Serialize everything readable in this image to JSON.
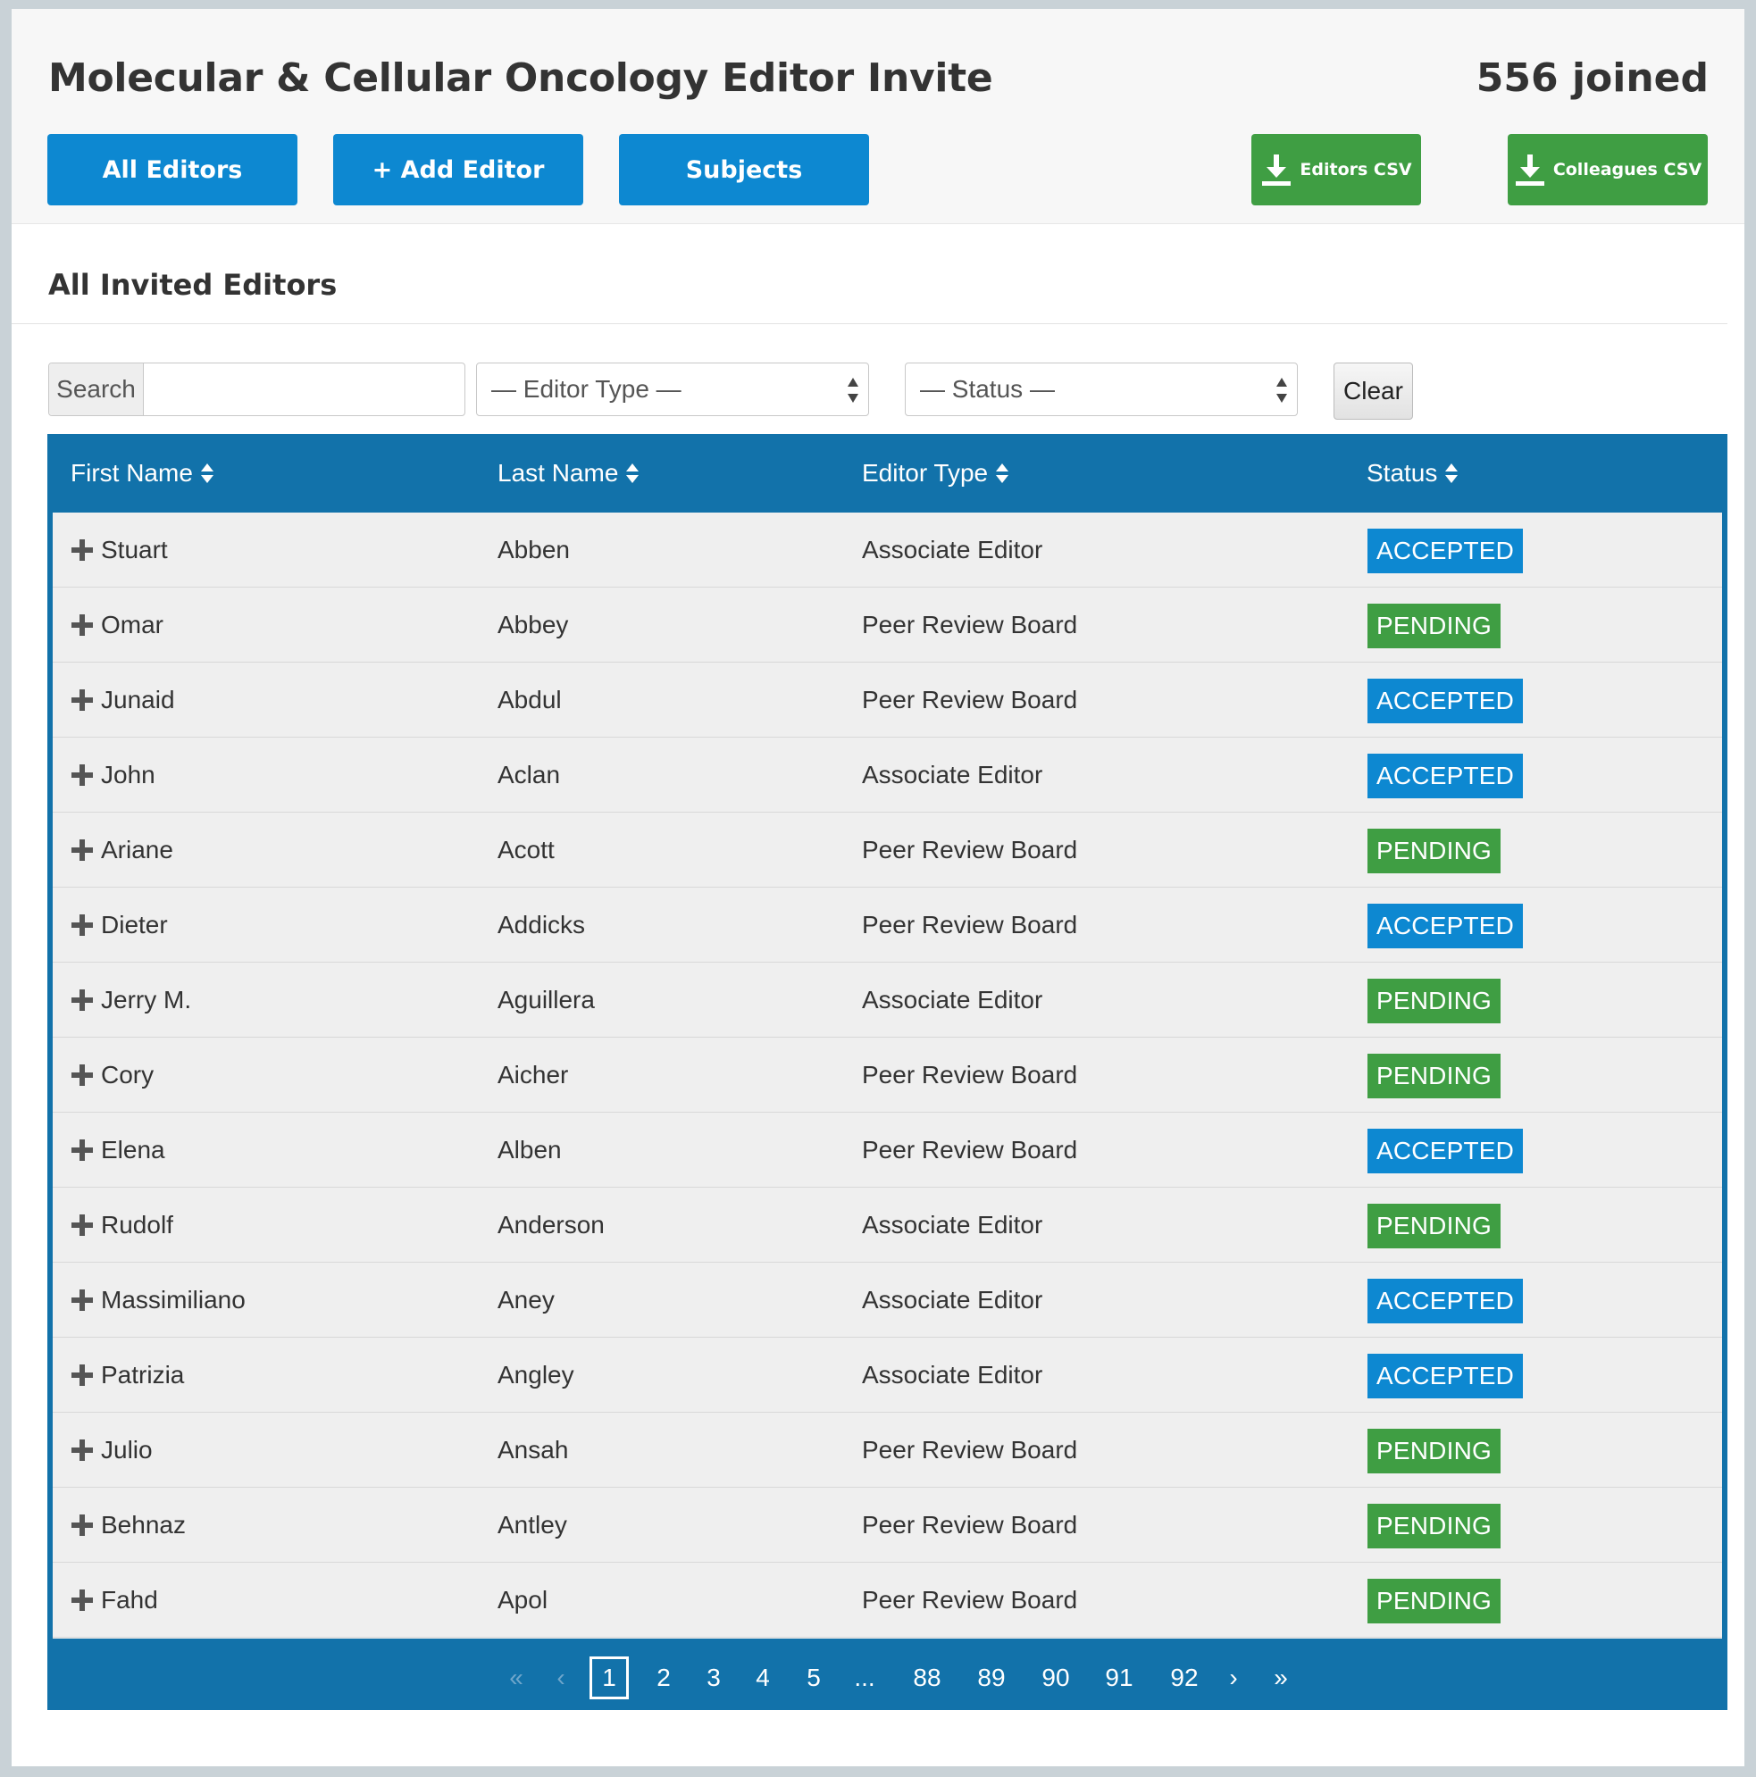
{
  "header": {
    "title": "Molecular & Cellular Oncology Editor Invite",
    "joined": "556 joined",
    "buttons": {
      "all_editors": "All Editors",
      "add_editor": "+ Add Editor",
      "subjects": "Subjects",
      "editors_csv": "Editors CSV",
      "colleagues_csv": "Colleagues CSV"
    }
  },
  "section": {
    "title": "All Invited Editors"
  },
  "filters": {
    "search_label": "Search",
    "search_value": "",
    "editor_type": "— Editor Type —",
    "status": "— Status —",
    "clear": "Clear"
  },
  "table": {
    "columns": [
      "First Name",
      "Last Name",
      "Editor Type",
      "Status"
    ],
    "rows": [
      {
        "first": "Stuart",
        "last": "Abben",
        "type": "Associate Editor",
        "status": "ACCEPTED"
      },
      {
        "first": "Omar",
        "last": "Abbey",
        "type": "Peer Review Board",
        "status": "PENDING"
      },
      {
        "first": "Junaid",
        "last": "Abdul",
        "type": "Peer Review Board",
        "status": "ACCEPTED"
      },
      {
        "first": "John",
        "last": "Aclan",
        "type": "Associate Editor",
        "status": "ACCEPTED"
      },
      {
        "first": "Ariane",
        "last": "Acott",
        "type": "Peer Review Board",
        "status": "PENDING"
      },
      {
        "first": "Dieter",
        "last": "Addicks",
        "type": "Peer Review Board",
        "status": "ACCEPTED"
      },
      {
        "first": "Jerry M.",
        "last": "Aguillera",
        "type": "Associate Editor",
        "status": "PENDING"
      },
      {
        "first": "Cory",
        "last": "Aicher",
        "type": "Peer Review Board",
        "status": "PENDING"
      },
      {
        "first": "Elena",
        "last": "Alben",
        "type": "Peer Review Board",
        "status": "ACCEPTED"
      },
      {
        "first": "Rudolf",
        "last": "Anderson",
        "type": "Associate Editor",
        "status": "PENDING"
      },
      {
        "first": "Massimiliano",
        "last": "Aney",
        "type": "Associate Editor",
        "status": "ACCEPTED"
      },
      {
        "first": "Patrizia",
        "last": "Angley",
        "type": "Associate Editor",
        "status": "ACCEPTED"
      },
      {
        "first": "Julio",
        "last": "Ansah",
        "type": "Peer Review Board",
        "status": "PENDING"
      },
      {
        "first": "Behnaz",
        "last": "Antley",
        "type": "Peer Review Board",
        "status": "PENDING"
      },
      {
        "first": "Fahd",
        "last": "Apol",
        "type": "Peer Review Board",
        "status": "PENDING"
      }
    ]
  },
  "pagination": {
    "first": "«",
    "prev": "‹",
    "pages": [
      "1",
      "2",
      "3",
      "4",
      "5",
      "...",
      "88",
      "89",
      "90",
      "91",
      "92"
    ],
    "current": "1",
    "next": "›",
    "last": "»"
  },
  "colors": {
    "accent_blue": "#0d88d1",
    "table_blue": "#1272aa",
    "green": "#3f9e43"
  },
  "icons": {
    "sort": "sort-icon",
    "expand": "plus-icon",
    "download": "download-icon",
    "select_arrows": "select-arrows-icon"
  }
}
